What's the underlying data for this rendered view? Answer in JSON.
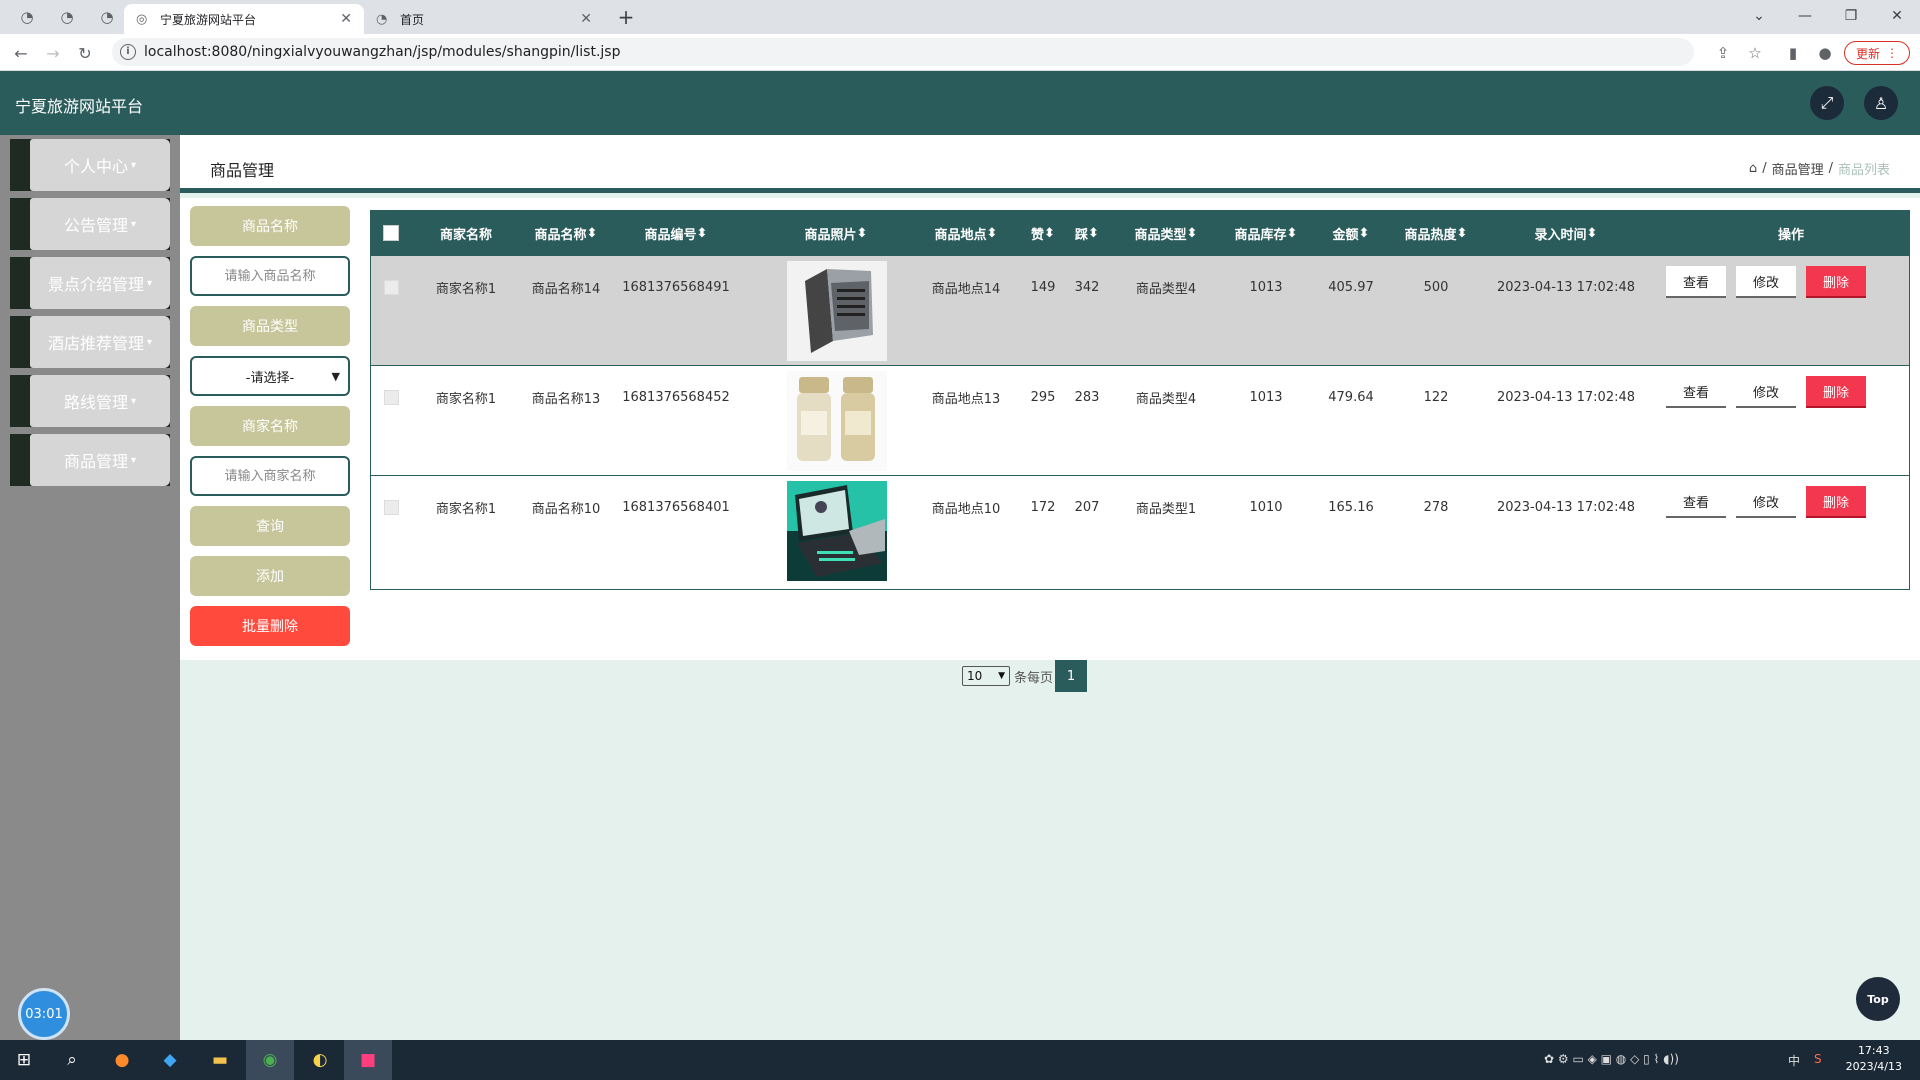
{
  "browser": {
    "tabs": [
      {
        "title": "宁夏旅游网站平台",
        "active": true
      },
      {
        "title": "首页",
        "active": false
      }
    ],
    "url": "localhost:8080/ningxialvyouwangzhan/jsp/modules/shangpin/list.jsp",
    "update_label": "更新"
  },
  "app": {
    "title": "宁夏旅游网站平台"
  },
  "sidebar": {
    "items": [
      {
        "label": "个人中心"
      },
      {
        "label": "公告管理"
      },
      {
        "label": "景点介绍管理"
      },
      {
        "label": "酒店推荐管理"
      },
      {
        "label": "路线管理"
      },
      {
        "label": "商品管理"
      }
    ],
    "timer": "03:01"
  },
  "page": {
    "title": "商品管理",
    "breadcrumb": [
      "商品管理",
      "商品列表"
    ]
  },
  "search": {
    "name_label": "商品名称",
    "name_placeholder": "请输入商品名称",
    "type_label": "商品类型",
    "type_selected": "-请选择-",
    "shop_label": "商家名称",
    "shop_placeholder": "请输入商家名称",
    "query_label": "查询",
    "add_label": "添加",
    "batch_delete_label": "批量删除"
  },
  "table": {
    "headers": [
      "商家名称",
      "商品名称",
      "商品编号",
      "商品照片",
      "商品地点",
      "赞",
      "踩",
      "商品类型",
      "商品库存",
      "金额",
      "商品热度",
      "录入时间",
      "操作"
    ],
    "sortable": [
      "商品名称",
      "商品编号",
      "商品照片",
      "商品地点",
      "赞",
      "踩",
      "商品类型",
      "商品库存",
      "金额",
      "商品热度",
      "录入时间"
    ],
    "rows": [
      {
        "shop": "商家名称1",
        "name": "商品名称14",
        "code": "1681376568491",
        "photo": "laptop-image",
        "place": "商品地点14",
        "like": "149",
        "dislike": "342",
        "type": "商品类型4",
        "stock": "1013",
        "price": "405.97",
        "heat": "500",
        "time": "2023-04-13 17:02:48"
      },
      {
        "shop": "商家名称1",
        "name": "商品名称13",
        "code": "1681376568452",
        "photo": "perfume-bottles-image",
        "place": "商品地点13",
        "like": "295",
        "dislike": "283",
        "type": "商品类型4",
        "stock": "1013",
        "price": "479.64",
        "heat": "122",
        "time": "2023-04-13 17:02:48"
      },
      {
        "shop": "商家名称1",
        "name": "商品名称10",
        "code": "1681376568401",
        "photo": "gaming-laptop-image",
        "place": "商品地点10",
        "like": "172",
        "dislike": "207",
        "type": "商品类型1",
        "stock": "1010",
        "price": "165.16",
        "heat": "278",
        "time": "2023-04-13 17:02:48"
      }
    ],
    "actions": {
      "view": "查看",
      "edit": "修改",
      "delete": "删除"
    }
  },
  "pagination": {
    "page_size": "10",
    "per_page_label": "条每页",
    "current_page": "1"
  },
  "top_label": "Top",
  "taskbar": {
    "time": "17:43",
    "date": "2023/4/13",
    "ime": "中"
  },
  "colors": {
    "primary": "#2b5c5c",
    "olive": "#c6c69a",
    "danger": "#ff4a3d",
    "delete": "#f2374e"
  }
}
